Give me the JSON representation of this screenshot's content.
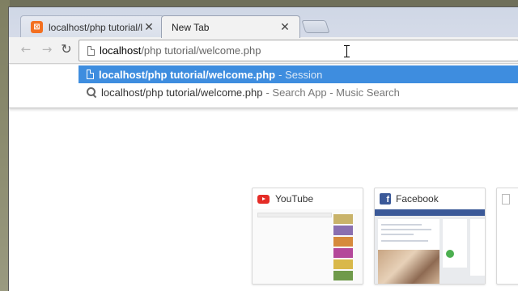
{
  "tabs": [
    {
      "title": "localhost/php tutorial/lo",
      "active": false
    },
    {
      "title": "New Tab",
      "active": true
    }
  ],
  "omnibox": {
    "host": "localhost",
    "path": "/php tutorial/welcome.php"
  },
  "suggestions": [
    {
      "main": "localhost/php tutorial/welcome.php",
      "desc": "- Session",
      "selected": true
    },
    {
      "main": "localhost/php tutorial/welcome.php",
      "desc": "- Search App - Music Search",
      "selected": false
    }
  ],
  "most_visited": [
    {
      "title": "YouTube",
      "icon": "youtube-icon"
    },
    {
      "title": "Facebook",
      "icon": "facebook-icon"
    },
    {
      "title": "",
      "icon": "blank-page-icon"
    }
  ],
  "colors": {
    "selection": "#3e8ddf",
    "youtube_red": "#e52d27",
    "facebook_blue": "#3b5998",
    "xampp_orange": "#f37021"
  }
}
